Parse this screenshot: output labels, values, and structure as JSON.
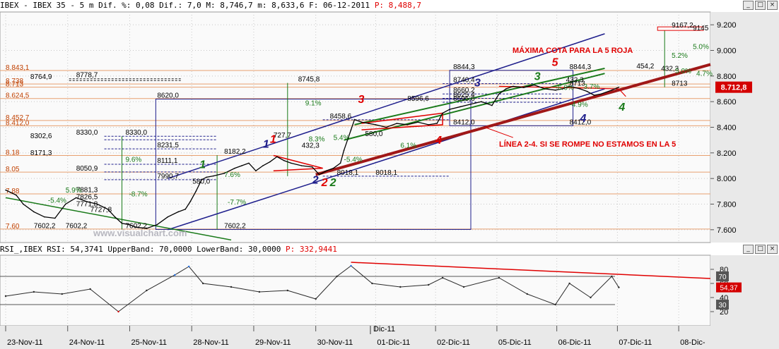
{
  "header": {
    "symbol": "IBEX - IBEX 35 -  5 m Dif. %: 0,08 Dif.: 7,0 M: 8,746,7 m: 8,633,6 F: 06-12-2011",
    "p_label": "P: 8,488,7"
  },
  "rsi_header": {
    "text": "RSI_,IBEX RSI: 54,3741 UpperBand: 70,0000 LowerBand: 30,0000",
    "p_label": "P: 332,9441"
  },
  "watermark": "www.visualchart.com",
  "current_price_tag": "8.712,8",
  "rsi_value_tag": "54,37",
  "rsi_band_upper_tag": "70",
  "rsi_band_lower_tag": "30",
  "colors": {
    "background": "#ffffff",
    "grid": "#c8c8c8",
    "price": "#000000",
    "channel_blue": "#1e1e8c",
    "trend_red": "#a01818",
    "green": "#1a7a1a",
    "annotation_red": "#e00000",
    "level_orange": "#e8a070",
    "rsi": "#2a2a2a",
    "rsi_overbought": "#1e6ee6",
    "rsi_oversold": "#e00000"
  },
  "chart_data": [
    {
      "type": "line",
      "title": "IBEX 35 - 5 m",
      "x_range": [
        0,
        1000
      ],
      "ylim": [
        7500,
        9300
      ],
      "y_ticks": [
        "9.200",
        "9.000",
        "8.800",
        "8.600",
        "8.400",
        "8.200",
        "8.000",
        "7.800",
        "7.600"
      ],
      "y_tick_values": [
        9200,
        9000,
        8800,
        8600,
        8400,
        8200,
        8000,
        7800,
        7600
      ],
      "x_tick_labels": [
        "23-Nov-11",
        "24-Nov-11",
        "25-Nov-11",
        "28-Nov-11",
        "29-Nov-11",
        "30-Nov-11",
        "01-Dic-11",
        "02-Dic-11",
        "05-Dic-11",
        "06-Dic-11",
        "07-Dic-11",
        "08-Dic-"
      ],
      "x_tick_positions": [
        0,
        88,
        176,
        264,
        352,
        440,
        525,
        610,
        697,
        782,
        868,
        955
      ],
      "month_marker": "Dic-11",
      "series": [
        {
          "x": [
            0,
            15,
            25,
            40,
            55,
            70,
            85,
            100,
            115,
            130,
            145,
            155,
            165,
            175,
            185,
            200,
            215,
            230,
            245,
            255,
            262,
            270,
            278,
            285,
            295,
            310,
            325,
            335,
            345,
            355,
            365,
            375,
            385,
            395,
            405,
            420,
            435,
            445,
            455,
            465,
            475,
            480,
            485,
            490,
            495,
            505,
            515,
            525,
            540,
            555,
            570,
            585,
            600,
            612,
            620,
            630,
            645,
            660,
            675,
            690,
            700,
            710,
            720,
            735,
            750,
            765,
            780,
            790,
            800,
            815,
            825,
            835,
            845,
            860,
            870
          ],
          "y": [
            7910,
            7870,
            7800,
            7740,
            7700,
            7690,
            7800,
            7850,
            7820,
            7800,
            7760,
            7700,
            7650,
            7640,
            7620,
            7610,
            7640,
            7700,
            7740,
            7760,
            7820,
            7900,
            7990,
            8010,
            8020,
            8040,
            8080,
            8100,
            8120,
            8060,
            8100,
            8130,
            8170,
            8140,
            8120,
            8100,
            8090,
            8030,
            8060,
            8080,
            8120,
            8220,
            8300,
            8380,
            8460,
            8440,
            8430,
            8420,
            8400,
            8430,
            8420,
            8440,
            8420,
            8430,
            8510,
            8540,
            8560,
            8580,
            8600,
            8570,
            8660,
            8700,
            8720,
            8710,
            8730,
            8700,
            8690,
            8700,
            8720,
            8700,
            8680,
            8650,
            8660,
            8690,
            8712.8
          ]
        }
      ]
    },
    {
      "type": "line",
      "title": "RSI",
      "ylim": [
        0,
        100
      ],
      "y_ticks": [
        "80",
        "60",
        "40",
        "20"
      ],
      "y_tick_values": [
        80,
        60,
        40,
        20
      ],
      "bands": [
        70,
        30
      ],
      "series": [
        {
          "x": [
            0,
            40,
            80,
            120,
            160,
            200,
            240,
            260,
            280,
            320,
            360,
            400,
            440,
            470,
            490,
            520,
            560,
            600,
            620,
            650,
            700,
            740,
            780,
            800,
            830,
            860,
            870
          ],
          "y": [
            42,
            48,
            45,
            52,
            20,
            50,
            72,
            84,
            60,
            55,
            48,
            50,
            38,
            70,
            85,
            60,
            55,
            58,
            68,
            55,
            68,
            45,
            30,
            60,
            40,
            70,
            54.37
          ]
        }
      ]
    }
  ],
  "labels": {
    "levels": [
      "8.843,1",
      "8.738",
      "8.713",
      "8.624,5",
      "8.452,7",
      "8.412,0",
      "8.18",
      "8.05",
      "7.88",
      "7.60"
    ],
    "values": [
      "8844,3",
      "8740,4",
      "8660,2",
      "8625,4",
      "8595,6",
      "8412,0",
      "8844,3",
      "8713",
      "8713",
      "8412,0",
      "8745,8",
      "8620,0",
      "8778,7",
      "8764,9",
      "8330,0",
      "8330,0",
      "8302,6",
      "8231,5",
      "8182,2",
      "8171,3",
      "8111,1",
      "8050,9",
      "7990,7",
      "7881,3",
      "7826,5",
      "7771,8",
      "7727,8",
      "7602,2",
      "7602,2",
      "7602,2",
      "7602,2",
      "8458,6",
      "8018,1",
      "8018,1",
      "8596,6",
      "9167,2",
      "9145",
      "454,2",
      "432,3",
      "432,3",
      "727,7",
      "580,0",
      "580,0",
      "432,3",
      "5.2%",
      "5.0%",
      "4.7%",
      "5.0%",
      "-4.9%",
      "9.1%",
      "9.6%",
      "7.6%",
      "-7.7%",
      "-5.4%",
      "5.4%",
      "-8.7%",
      "8.3%",
      "5.9%",
      "-5.4%",
      "6.1%",
      "-6.0%",
      "3.7%"
    ],
    "wave_numbers": [
      "1",
      "2",
      "3",
      "4",
      "5",
      "1",
      "2",
      "3",
      "4",
      "1",
      "2",
      "3",
      "4"
    ],
    "note_max": "MÁXIMA COTA PARA LA 5 ROJA",
    "note_line": "LÍNEA 2-4. SI SE ROMPE NO ESTAMOS EN LA 5"
  }
}
